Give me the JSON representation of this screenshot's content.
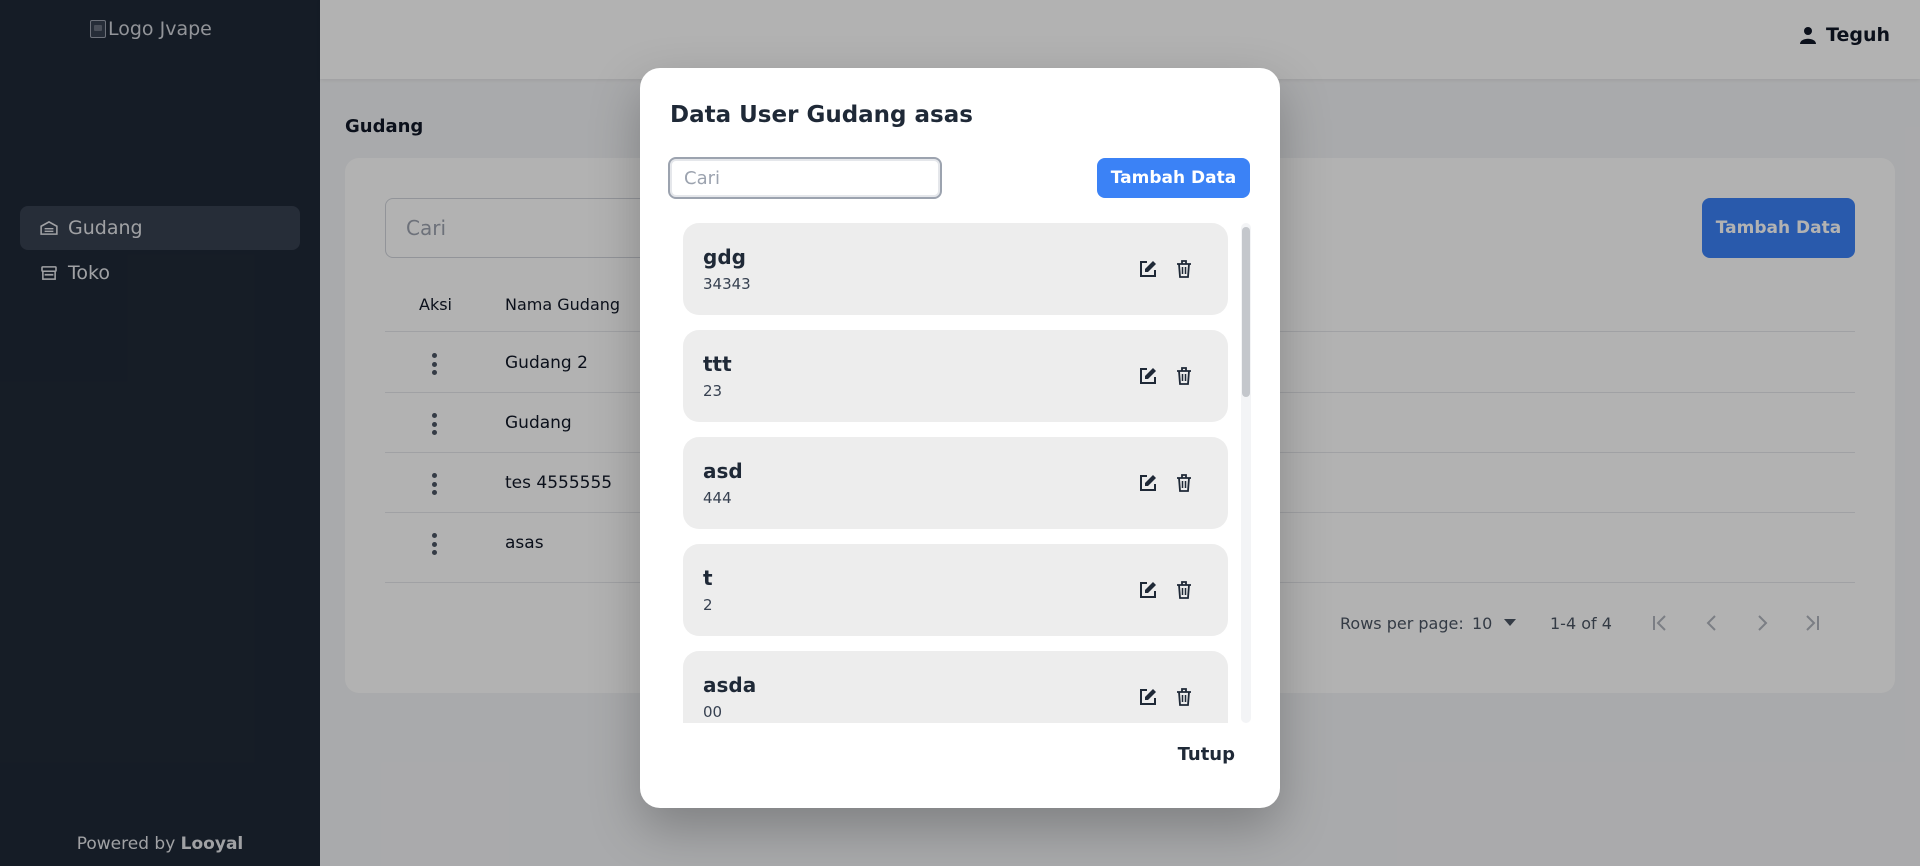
{
  "sidebar": {
    "logo_alt": "Logo Jvape",
    "items": [
      {
        "label": "Gudang",
        "icon": "warehouse-icon",
        "active": true
      },
      {
        "label": "Toko",
        "icon": "store-icon",
        "active": false
      }
    ],
    "powered_prefix": "Powered by",
    "powered_brand": "Looyal"
  },
  "topbar": {
    "user_name": "Teguh",
    "user_icon": "user-icon"
  },
  "main": {
    "page_title": "Gudang",
    "search_placeholder": "Cari",
    "add_button": "Tambah Data",
    "columns": [
      "Aksi",
      "Nama Gudang"
    ],
    "rows": [
      {
        "nama": "Gudang 2"
      },
      {
        "nama": "Gudang"
      },
      {
        "nama": "tes 4555555"
      },
      {
        "nama": "asas"
      }
    ],
    "pagination": {
      "rows_per_page_label": "Rows per page:",
      "rows_per_page_value": "10",
      "range": "1-4 of 4"
    }
  },
  "modal": {
    "title": "Data User Gudang asas",
    "search_placeholder": "Cari",
    "add_button": "Tambah Data",
    "items": [
      {
        "name": "gdg",
        "code": "34343"
      },
      {
        "name": "ttt",
        "code": "23"
      },
      {
        "name": "asd",
        "code": "444"
      },
      {
        "name": "t",
        "code": "2"
      },
      {
        "name": "asda",
        "code": "00"
      }
    ],
    "close_button": "Tutup"
  },
  "colors": {
    "sidebar_bg": "#1f2937",
    "accent": "#3b82f6",
    "item_bg": "#ededed"
  }
}
